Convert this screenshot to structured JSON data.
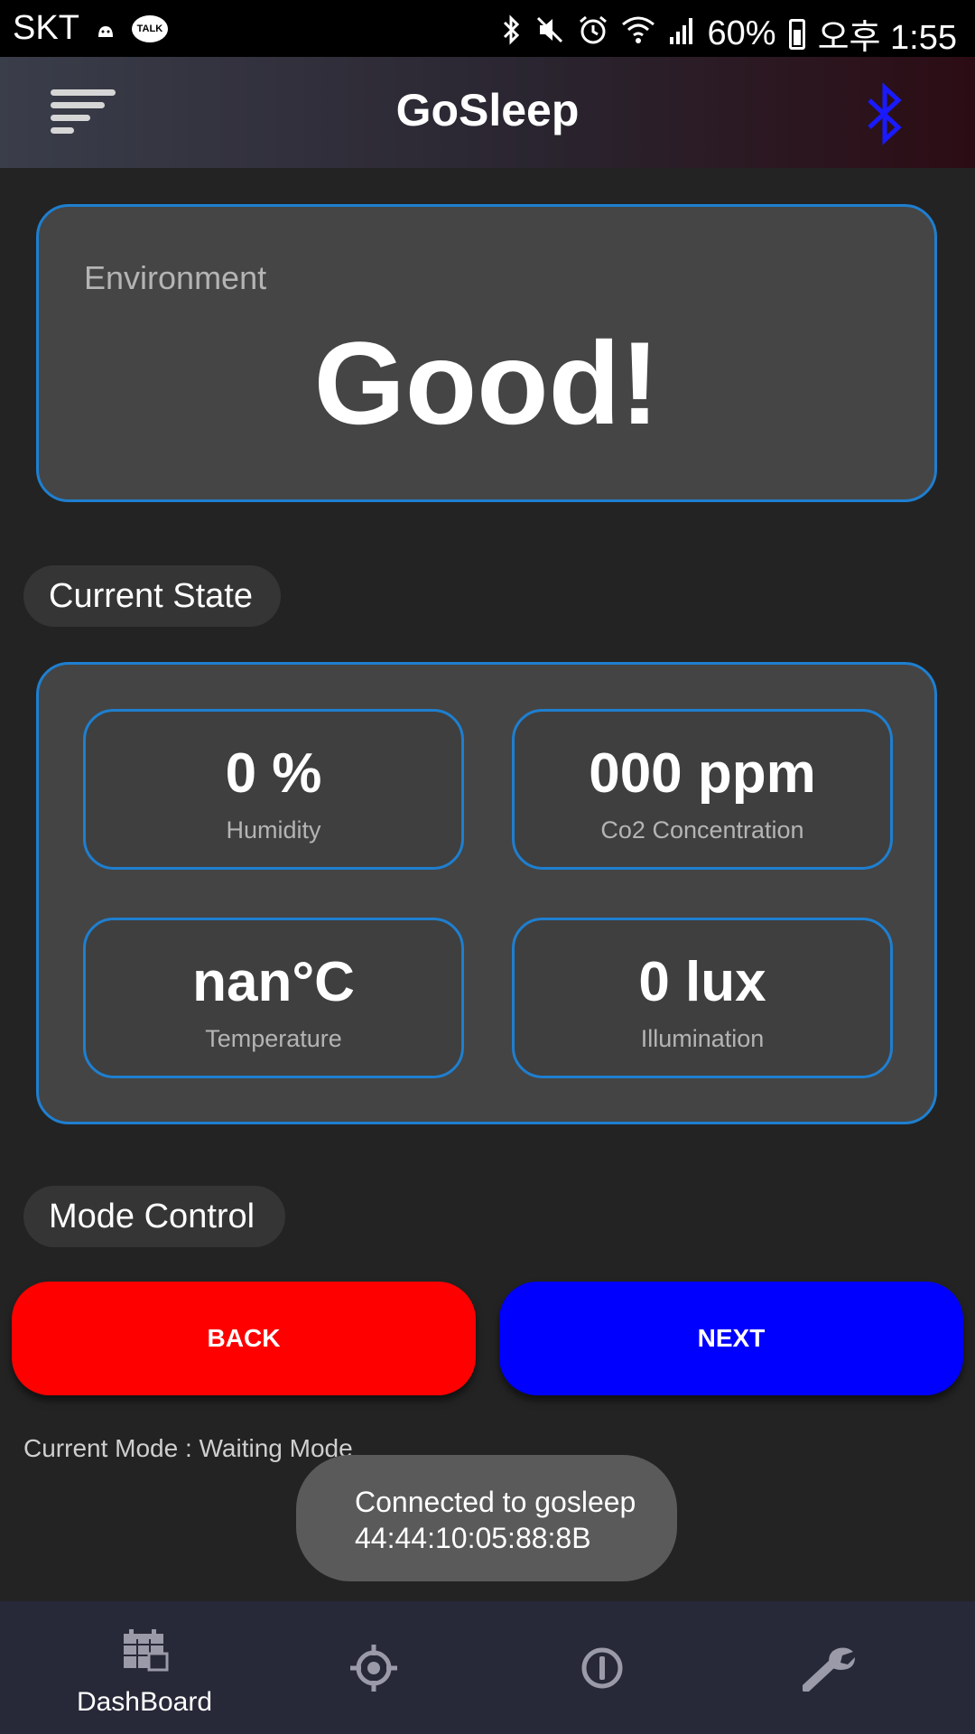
{
  "status_bar": {
    "carrier": "SKT",
    "talk_badge": "TALK",
    "battery_percent": "60%",
    "time": "오후 1:55"
  },
  "header": {
    "title": "GoSleep",
    "menu_icon": "menu-icon",
    "bluetooth_icon": "bluetooth-icon",
    "bluetooth_color": "#1a1aff"
  },
  "environment": {
    "label": "Environment",
    "value": "Good!"
  },
  "current_state": {
    "heading": "Current State",
    "metrics": [
      {
        "value": "0 %",
        "label": "Humidity"
      },
      {
        "value": "000 ppm",
        "label": "Co2 Concentration"
      },
      {
        "value": "nan°C",
        "label": "Temperature"
      },
      {
        "value": "0 lux",
        "label": "Illumination"
      }
    ]
  },
  "mode_control": {
    "heading": "Mode Control",
    "back_label": "BACK",
    "back_color": "#ff0000",
    "next_label": "NEXT",
    "next_color": "#0000ff",
    "current_mode": "Current Mode : Waiting Mode"
  },
  "toast": {
    "line1": "Connected to gosleep",
    "line2": "44:44:10:05:88:8B"
  },
  "bottom_nav": {
    "items": [
      {
        "label": "DashBoard",
        "icon": "dashboard-icon"
      },
      {
        "label": "",
        "icon": "crosshair-icon"
      },
      {
        "label": "",
        "icon": "info-icon"
      },
      {
        "label": "",
        "icon": "wrench-icon"
      }
    ]
  },
  "colors": {
    "accent_border": "#1e7fd0",
    "background": "#232323"
  }
}
